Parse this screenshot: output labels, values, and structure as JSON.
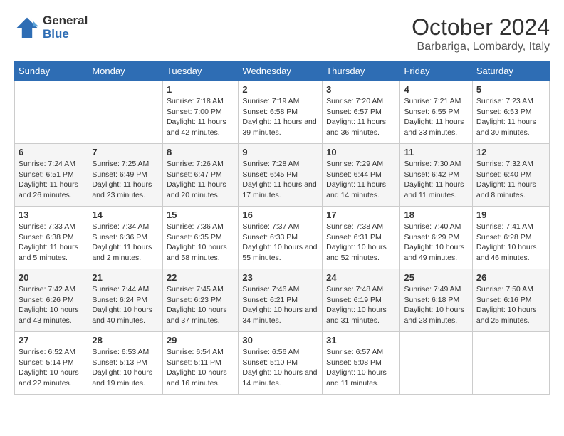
{
  "logo": {
    "line1": "General",
    "line2": "Blue"
  },
  "title": "October 2024",
  "location": "Barbariga, Lombardy, Italy",
  "days_of_week": [
    "Sunday",
    "Monday",
    "Tuesday",
    "Wednesday",
    "Thursday",
    "Friday",
    "Saturday"
  ],
  "weeks": [
    [
      {
        "num": "",
        "sunrise": "",
        "sunset": "",
        "daylight": ""
      },
      {
        "num": "",
        "sunrise": "",
        "sunset": "",
        "daylight": ""
      },
      {
        "num": "1",
        "sunrise": "Sunrise: 7:18 AM",
        "sunset": "Sunset: 7:00 PM",
        "daylight": "Daylight: 11 hours and 42 minutes."
      },
      {
        "num": "2",
        "sunrise": "Sunrise: 7:19 AM",
        "sunset": "Sunset: 6:58 PM",
        "daylight": "Daylight: 11 hours and 39 minutes."
      },
      {
        "num": "3",
        "sunrise": "Sunrise: 7:20 AM",
        "sunset": "Sunset: 6:57 PM",
        "daylight": "Daylight: 11 hours and 36 minutes."
      },
      {
        "num": "4",
        "sunrise": "Sunrise: 7:21 AM",
        "sunset": "Sunset: 6:55 PM",
        "daylight": "Daylight: 11 hours and 33 minutes."
      },
      {
        "num": "5",
        "sunrise": "Sunrise: 7:23 AM",
        "sunset": "Sunset: 6:53 PM",
        "daylight": "Daylight: 11 hours and 30 minutes."
      }
    ],
    [
      {
        "num": "6",
        "sunrise": "Sunrise: 7:24 AM",
        "sunset": "Sunset: 6:51 PM",
        "daylight": "Daylight: 11 hours and 26 minutes."
      },
      {
        "num": "7",
        "sunrise": "Sunrise: 7:25 AM",
        "sunset": "Sunset: 6:49 PM",
        "daylight": "Daylight: 11 hours and 23 minutes."
      },
      {
        "num": "8",
        "sunrise": "Sunrise: 7:26 AM",
        "sunset": "Sunset: 6:47 PM",
        "daylight": "Daylight: 11 hours and 20 minutes."
      },
      {
        "num": "9",
        "sunrise": "Sunrise: 7:28 AM",
        "sunset": "Sunset: 6:45 PM",
        "daylight": "Daylight: 11 hours and 17 minutes."
      },
      {
        "num": "10",
        "sunrise": "Sunrise: 7:29 AM",
        "sunset": "Sunset: 6:44 PM",
        "daylight": "Daylight: 11 hours and 14 minutes."
      },
      {
        "num": "11",
        "sunrise": "Sunrise: 7:30 AM",
        "sunset": "Sunset: 6:42 PM",
        "daylight": "Daylight: 11 hours and 11 minutes."
      },
      {
        "num": "12",
        "sunrise": "Sunrise: 7:32 AM",
        "sunset": "Sunset: 6:40 PM",
        "daylight": "Daylight: 11 hours and 8 minutes."
      }
    ],
    [
      {
        "num": "13",
        "sunrise": "Sunrise: 7:33 AM",
        "sunset": "Sunset: 6:38 PM",
        "daylight": "Daylight: 11 hours and 5 minutes."
      },
      {
        "num": "14",
        "sunrise": "Sunrise: 7:34 AM",
        "sunset": "Sunset: 6:36 PM",
        "daylight": "Daylight: 11 hours and 2 minutes."
      },
      {
        "num": "15",
        "sunrise": "Sunrise: 7:36 AM",
        "sunset": "Sunset: 6:35 PM",
        "daylight": "Daylight: 10 hours and 58 minutes."
      },
      {
        "num": "16",
        "sunrise": "Sunrise: 7:37 AM",
        "sunset": "Sunset: 6:33 PM",
        "daylight": "Daylight: 10 hours and 55 minutes."
      },
      {
        "num": "17",
        "sunrise": "Sunrise: 7:38 AM",
        "sunset": "Sunset: 6:31 PM",
        "daylight": "Daylight: 10 hours and 52 minutes."
      },
      {
        "num": "18",
        "sunrise": "Sunrise: 7:40 AM",
        "sunset": "Sunset: 6:29 PM",
        "daylight": "Daylight: 10 hours and 49 minutes."
      },
      {
        "num": "19",
        "sunrise": "Sunrise: 7:41 AM",
        "sunset": "Sunset: 6:28 PM",
        "daylight": "Daylight: 10 hours and 46 minutes."
      }
    ],
    [
      {
        "num": "20",
        "sunrise": "Sunrise: 7:42 AM",
        "sunset": "Sunset: 6:26 PM",
        "daylight": "Daylight: 10 hours and 43 minutes."
      },
      {
        "num": "21",
        "sunrise": "Sunrise: 7:44 AM",
        "sunset": "Sunset: 6:24 PM",
        "daylight": "Daylight: 10 hours and 40 minutes."
      },
      {
        "num": "22",
        "sunrise": "Sunrise: 7:45 AM",
        "sunset": "Sunset: 6:23 PM",
        "daylight": "Daylight: 10 hours and 37 minutes."
      },
      {
        "num": "23",
        "sunrise": "Sunrise: 7:46 AM",
        "sunset": "Sunset: 6:21 PM",
        "daylight": "Daylight: 10 hours and 34 minutes."
      },
      {
        "num": "24",
        "sunrise": "Sunrise: 7:48 AM",
        "sunset": "Sunset: 6:19 PM",
        "daylight": "Daylight: 10 hours and 31 minutes."
      },
      {
        "num": "25",
        "sunrise": "Sunrise: 7:49 AM",
        "sunset": "Sunset: 6:18 PM",
        "daylight": "Daylight: 10 hours and 28 minutes."
      },
      {
        "num": "26",
        "sunrise": "Sunrise: 7:50 AM",
        "sunset": "Sunset: 6:16 PM",
        "daylight": "Daylight: 10 hours and 25 minutes."
      }
    ],
    [
      {
        "num": "27",
        "sunrise": "Sunrise: 6:52 AM",
        "sunset": "Sunset: 5:14 PM",
        "daylight": "Daylight: 10 hours and 22 minutes."
      },
      {
        "num": "28",
        "sunrise": "Sunrise: 6:53 AM",
        "sunset": "Sunset: 5:13 PM",
        "daylight": "Daylight: 10 hours and 19 minutes."
      },
      {
        "num": "29",
        "sunrise": "Sunrise: 6:54 AM",
        "sunset": "Sunset: 5:11 PM",
        "daylight": "Daylight: 10 hours and 16 minutes."
      },
      {
        "num": "30",
        "sunrise": "Sunrise: 6:56 AM",
        "sunset": "Sunset: 5:10 PM",
        "daylight": "Daylight: 10 hours and 14 minutes."
      },
      {
        "num": "31",
        "sunrise": "Sunrise: 6:57 AM",
        "sunset": "Sunset: 5:08 PM",
        "daylight": "Daylight: 10 hours and 11 minutes."
      },
      {
        "num": "",
        "sunrise": "",
        "sunset": "",
        "daylight": ""
      },
      {
        "num": "",
        "sunrise": "",
        "sunset": "",
        "daylight": ""
      }
    ]
  ]
}
